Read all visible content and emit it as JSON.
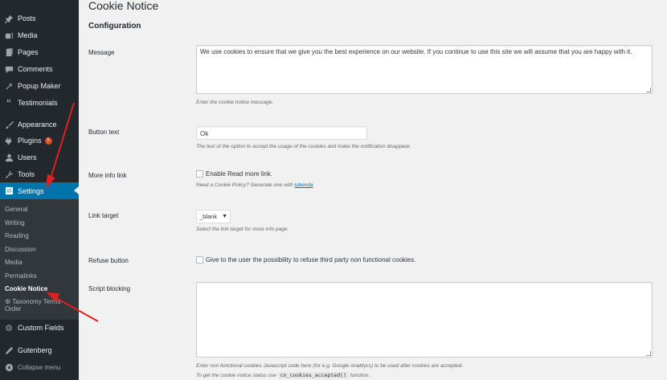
{
  "sidebar": {
    "items": [
      {
        "label": "Posts",
        "icon": "pin-icon"
      },
      {
        "label": "Media",
        "icon": "media-icon"
      },
      {
        "label": "Pages",
        "icon": "pages-icon"
      },
      {
        "label": "Comments",
        "icon": "comments-icon"
      },
      {
        "label": "Popup Maker",
        "icon": "popup-icon"
      },
      {
        "label": "Testimonials",
        "icon": "quote-icon"
      },
      {
        "label": "Appearance",
        "icon": "brush-icon"
      },
      {
        "label": "Plugins",
        "icon": "plugin-icon",
        "badge": "5"
      },
      {
        "label": "Users",
        "icon": "user-icon"
      },
      {
        "label": "Tools",
        "icon": "wrench-icon"
      },
      {
        "label": "Settings",
        "icon": "settings-icon"
      },
      {
        "label": "Custom Fields",
        "icon": "cog-icon"
      },
      {
        "label": "Gutenberg",
        "icon": "pen-icon"
      },
      {
        "label": "Collapse menu",
        "icon": "collapse-icon"
      }
    ],
    "submenu": [
      {
        "label": "General"
      },
      {
        "label": "Writing"
      },
      {
        "label": "Reading"
      },
      {
        "label": "Discussion"
      },
      {
        "label": "Media"
      },
      {
        "label": "Permalinks"
      },
      {
        "label": "Cookie Notice"
      },
      {
        "label": "Taxonomy Terms",
        "label2": "Order"
      }
    ]
  },
  "page": {
    "title": "Cookie Notice",
    "section": "Configuration"
  },
  "fields": {
    "message": {
      "label": "Message",
      "value": "We use cookies to ensure that we give you the best experience on our website. If you continue to use this site we will assume that you are happy with it.",
      "desc": "Enter the cookie notice message."
    },
    "button_text": {
      "label": "Button text",
      "value": "Ok",
      "desc": "The text of the option to accept the usage of the cookies and make the notification disappear."
    },
    "more_info": {
      "label": "More info link",
      "checkbox_label": "Enable Read more link.",
      "desc_prefix": "Need a Cookie Policy? Generate one with ",
      "desc_link": "iubenda"
    },
    "link_target": {
      "label": "Link target",
      "value": "_blank",
      "desc": "Select the link target for more info page."
    },
    "refuse": {
      "label": "Refuse button",
      "checkbox_label": "Give to the user the possibility to refuse third party non functional cookies."
    },
    "script_blocking": {
      "label": "Script blocking",
      "value": "",
      "desc1": "Enter non functional cookies Javascript code here (for e.g. Google Analitycs) to be used after cookies are accepted.",
      "desc2_prefix": "To get the cookie notice status use ",
      "desc2_code": "cn_cookies_accepted()",
      "desc2_suffix": " function."
    }
  },
  "colors": {
    "sidebar_bg": "#23282d",
    "submenu_bg": "#32373c",
    "accent": "#0073aa",
    "badge": "#d54e21",
    "annotation_arrow": "#e02020"
  }
}
